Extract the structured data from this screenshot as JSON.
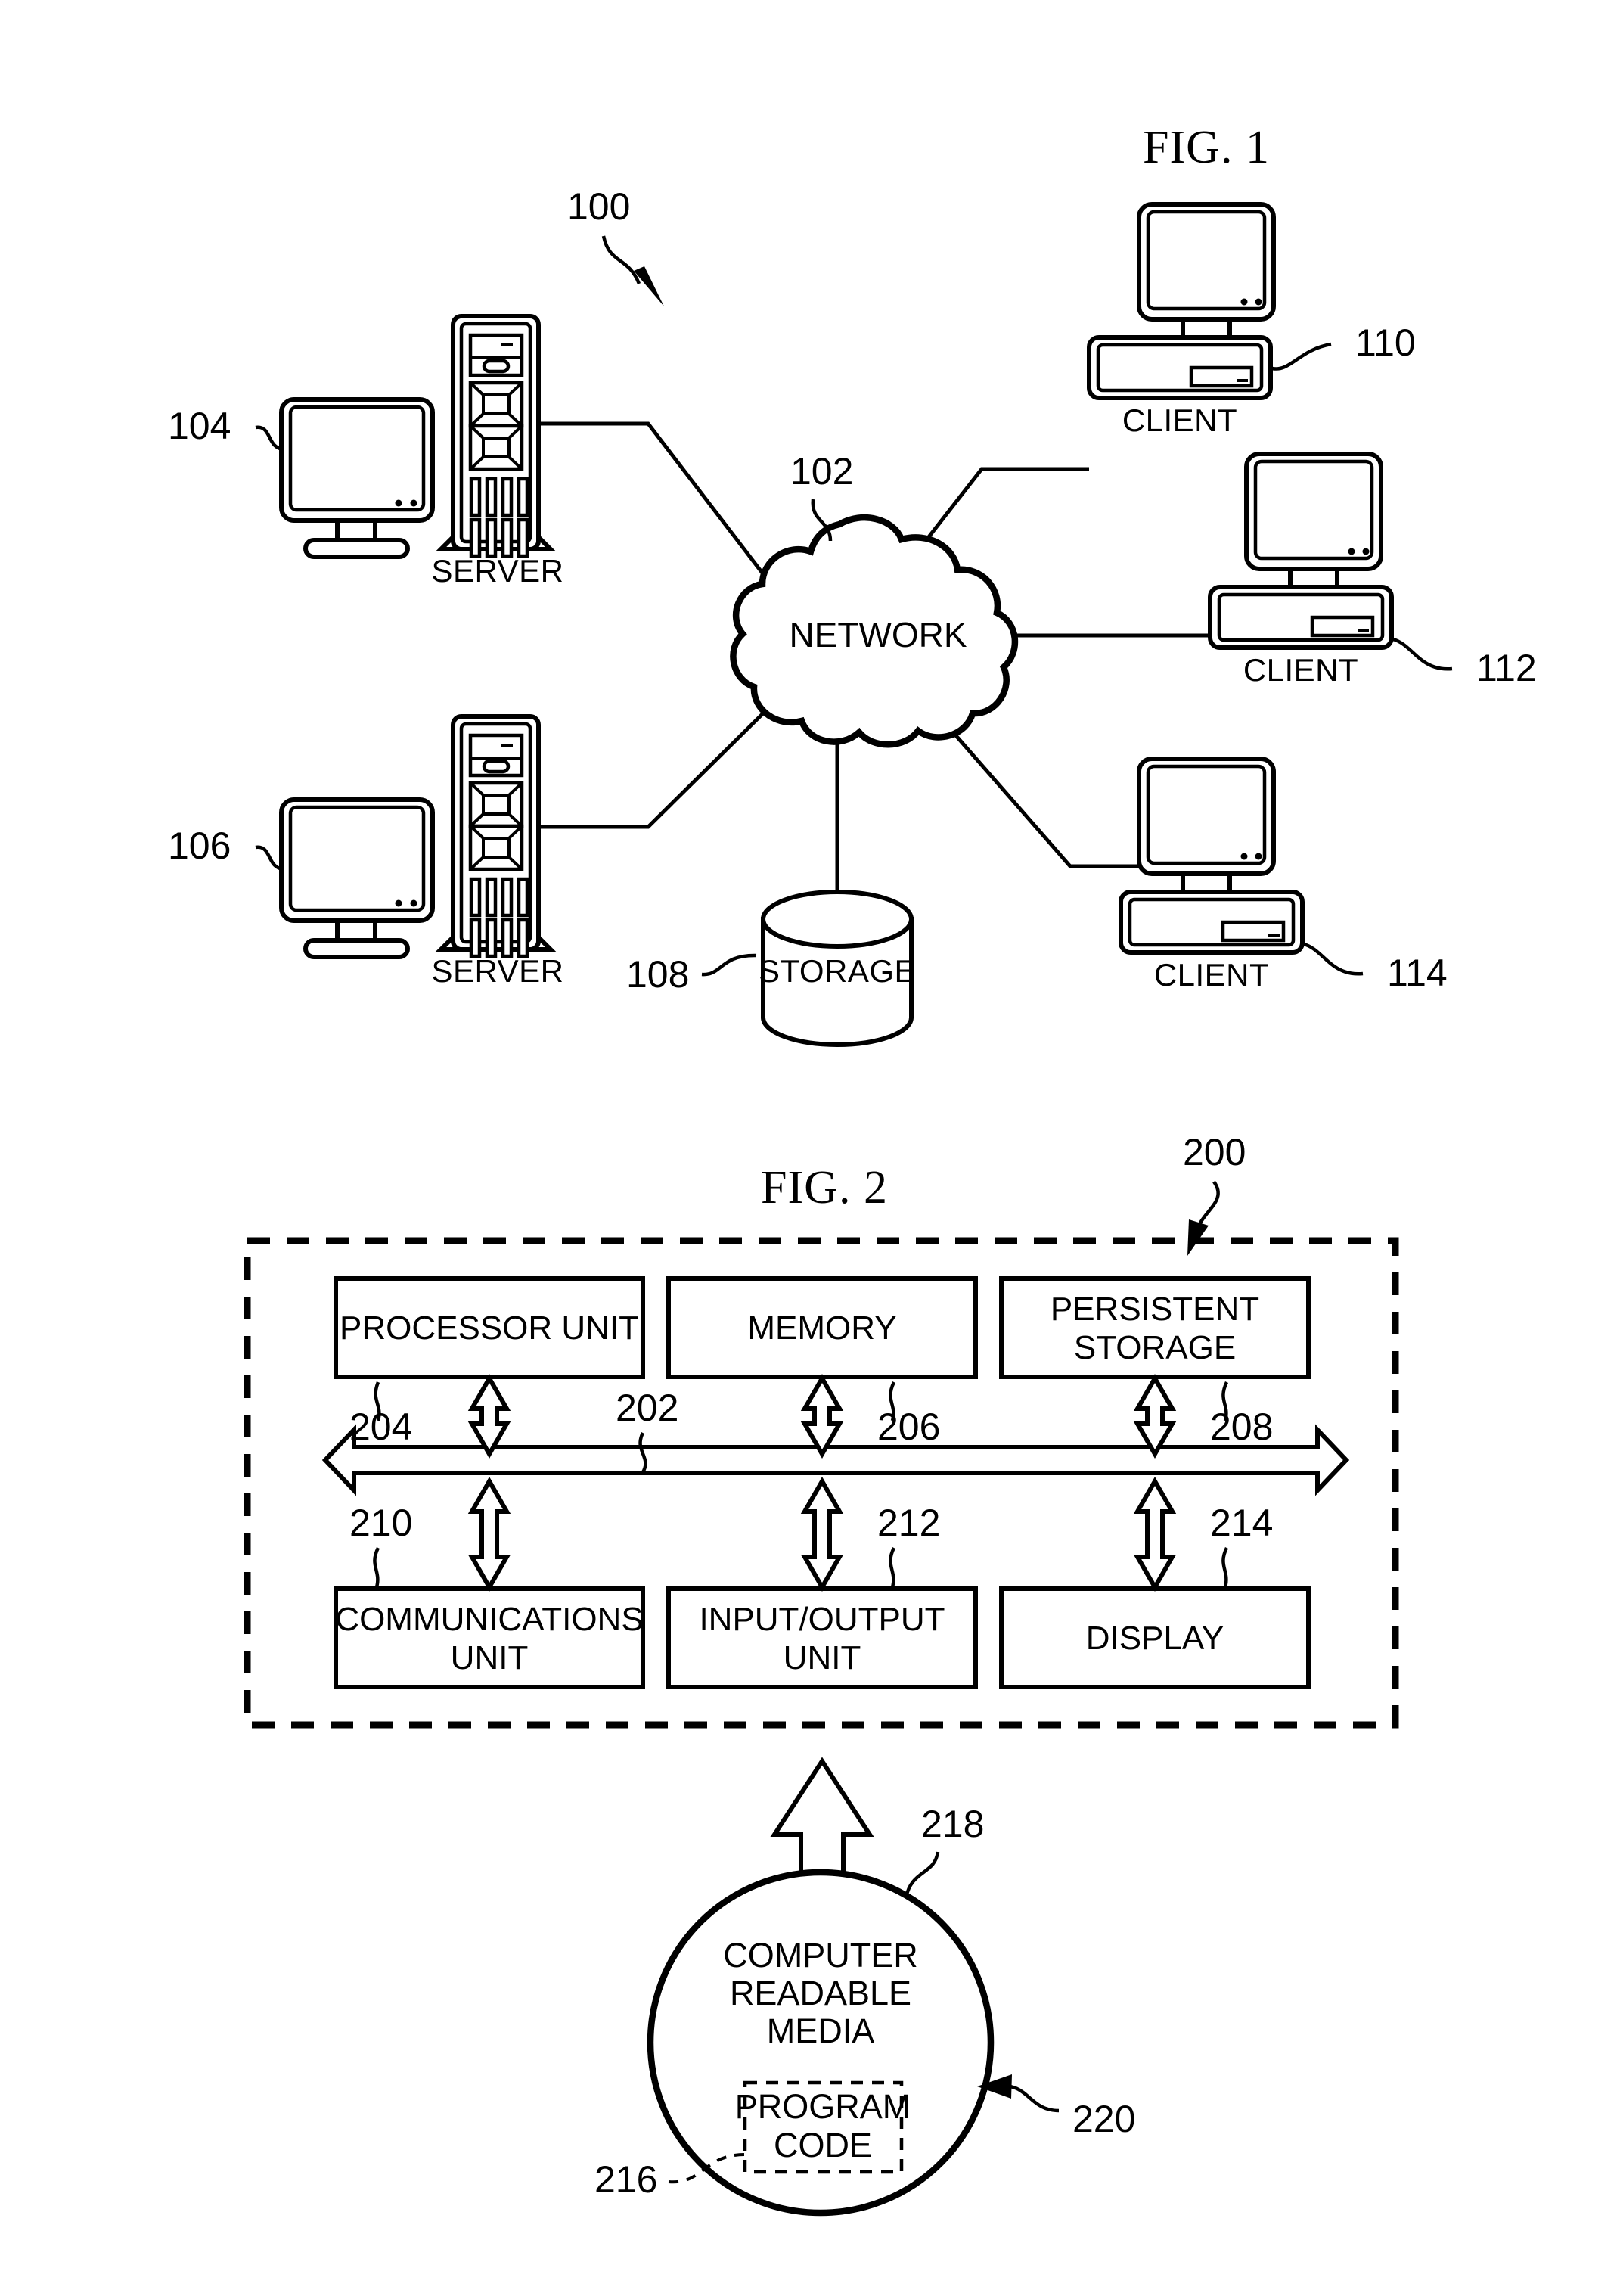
{
  "figures": [
    {
      "id": "fig1",
      "title": "FIG. 1",
      "system_ref": "100",
      "network": {
        "label": "NETWORK",
        "ref": "102"
      },
      "storage": {
        "label": "STORAGE",
        "ref": "108"
      },
      "servers": [
        {
          "label": "SERVER",
          "ref": "104"
        },
        {
          "label": "SERVER",
          "ref": "106"
        }
      ],
      "clients": [
        {
          "label": "CLIENT",
          "ref": "110"
        },
        {
          "label": "CLIENT",
          "ref": "112"
        },
        {
          "label": "CLIENT",
          "ref": "114"
        }
      ]
    },
    {
      "id": "fig2",
      "title": "FIG. 2",
      "system_ref": "200",
      "bus_ref": "202",
      "top_boxes": [
        {
          "lines": [
            "PROCESSOR UNIT"
          ],
          "ref": "204"
        },
        {
          "lines": [
            "MEMORY"
          ],
          "ref": "206"
        },
        {
          "lines": [
            "PERSISTENT",
            "STORAGE"
          ],
          "ref": "208"
        }
      ],
      "bottom_boxes": [
        {
          "lines": [
            "COMMUNICATIONS",
            "UNIT"
          ],
          "ref": "210"
        },
        {
          "lines": [
            "INPUT/OUTPUT",
            "UNIT"
          ],
          "ref": "212"
        },
        {
          "lines": [
            "DISPLAY"
          ],
          "ref": "214"
        }
      ],
      "media": {
        "lines": [
          "COMPUTER",
          "READABLE",
          "MEDIA"
        ],
        "ref": "218",
        "outer_ref": "220",
        "program_code": {
          "lines": [
            "PROGRAM",
            "CODE"
          ],
          "ref": "216"
        }
      }
    }
  ],
  "colors": {
    "ink": "#000000",
    "paper": "#ffffff"
  }
}
